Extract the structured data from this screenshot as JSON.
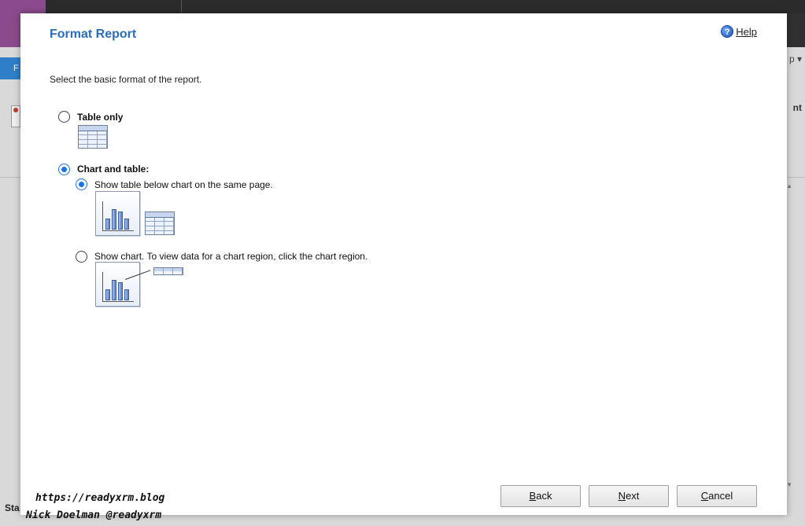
{
  "background": {
    "tab_letter": "F",
    "right_menu": "p ▾",
    "right_label": "nt",
    "status_text": "Sta"
  },
  "dialog": {
    "title": "Format Report",
    "help_label": "Help",
    "intro": "Select the basic format of the report.",
    "options": {
      "table_only": {
        "label": "Table only",
        "selected": false
      },
      "chart_and_table": {
        "label": "Chart and table:",
        "selected": true,
        "sub_options": [
          {
            "label": "Show table below chart on the same page.",
            "selected": true
          },
          {
            "label": "Show chart. To view data for a chart region, click the chart region.",
            "selected": false
          }
        ]
      }
    },
    "buttons": {
      "back": {
        "label": "Back",
        "accel": "B"
      },
      "next": {
        "label": "Next",
        "accel": "N"
      },
      "cancel": {
        "label": "Cancel",
        "accel": "C"
      }
    }
  },
  "watermark": {
    "line1": "https://readyxrm.blog",
    "line2": "Nick Doelman @readyxrm"
  },
  "colors": {
    "title": "#2a6ebb",
    "radio_selected": "#1a73e8",
    "app_accent": "#8b4a8c"
  }
}
